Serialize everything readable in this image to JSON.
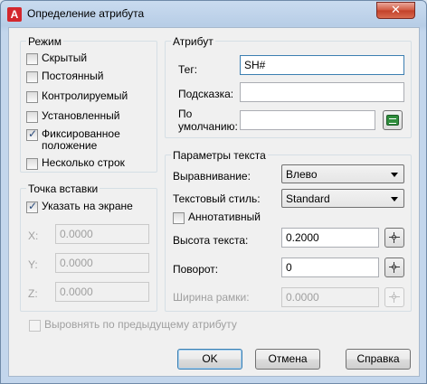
{
  "window": {
    "title": "Определение атрибута",
    "app_icon": "A",
    "close_symbol": "✕"
  },
  "mode": {
    "title": "Режим",
    "options": [
      {
        "label": "Скрытый",
        "checked": false
      },
      {
        "label": "Постоянный",
        "checked": false
      },
      {
        "label": "Контролируемый",
        "checked": false
      },
      {
        "label": "Установленный",
        "checked": false
      },
      {
        "label": "Фиксированное положение",
        "checked": true
      },
      {
        "label": "Несколько строк",
        "checked": false
      }
    ]
  },
  "insertion_point": {
    "title": "Точка вставки",
    "specify_on_screen": {
      "label": "Указать на экране",
      "checked": true
    },
    "x": {
      "label": "X:",
      "value": "0.0000"
    },
    "y": {
      "label": "Y:",
      "value": "0.0000"
    },
    "z": {
      "label": "Z:",
      "value": "0.0000"
    }
  },
  "attribute": {
    "title": "Атрибут",
    "tag": {
      "label": "Тег:",
      "value": "SH#"
    },
    "prompt": {
      "label": "Подсказка:",
      "value": ""
    },
    "default": {
      "label_line1": "По",
      "label_line2": "умолчанию:",
      "value": ""
    }
  },
  "text_settings": {
    "title": "Параметры текста",
    "justification": {
      "label": "Выравнивание:",
      "value": "Влево"
    },
    "text_style": {
      "label": "Текстовый стиль:",
      "value": "Standard"
    },
    "annotative": {
      "label": "Аннотативный",
      "checked": false
    },
    "text_height": {
      "label": "Высота текста:",
      "value": "0.2000"
    },
    "rotation": {
      "label": "Поворот:",
      "value": "0"
    },
    "boundary_width": {
      "label": "Ширина рамки:",
      "value": "0.0000"
    }
  },
  "align_below": {
    "label": "Выровнять по предыдущему атрибуту",
    "checked": false
  },
  "buttons": {
    "ok": "OK",
    "cancel": "Отмена",
    "help": "Справка"
  },
  "icons": {
    "app": "autocad-a-icon",
    "close": "close-icon",
    "pick": "crosshair-pick-icon",
    "insert_field": "insert-field-icon"
  }
}
